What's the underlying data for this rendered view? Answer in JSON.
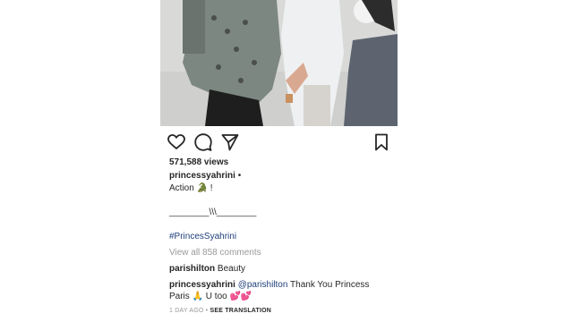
{
  "post": {
    "views": "571,588 views",
    "username": "princessyahrini",
    "username_suffix": " •",
    "caption_line1": "Action 🐊 !",
    "caption_separator": "________\\\\\\________",
    "hashtag": "#PrincesSyahrini",
    "view_all_comments": "View all 858 comments",
    "comments": [
      {
        "user": "parishilton",
        "text": " Beauty"
      },
      {
        "user": "princessyahrini",
        "mention": " @parishilton",
        "text": " Thank You Princess Paris 🙏 U too 💕💕"
      }
    ],
    "timestamp": "1 DAY AGO",
    "separator": " • ",
    "see_translation": "SEE TRANSLATION"
  },
  "icons": {
    "like": "heart-icon",
    "comment": "comment-icon",
    "share": "send-icon",
    "save": "bookmark-icon"
  }
}
